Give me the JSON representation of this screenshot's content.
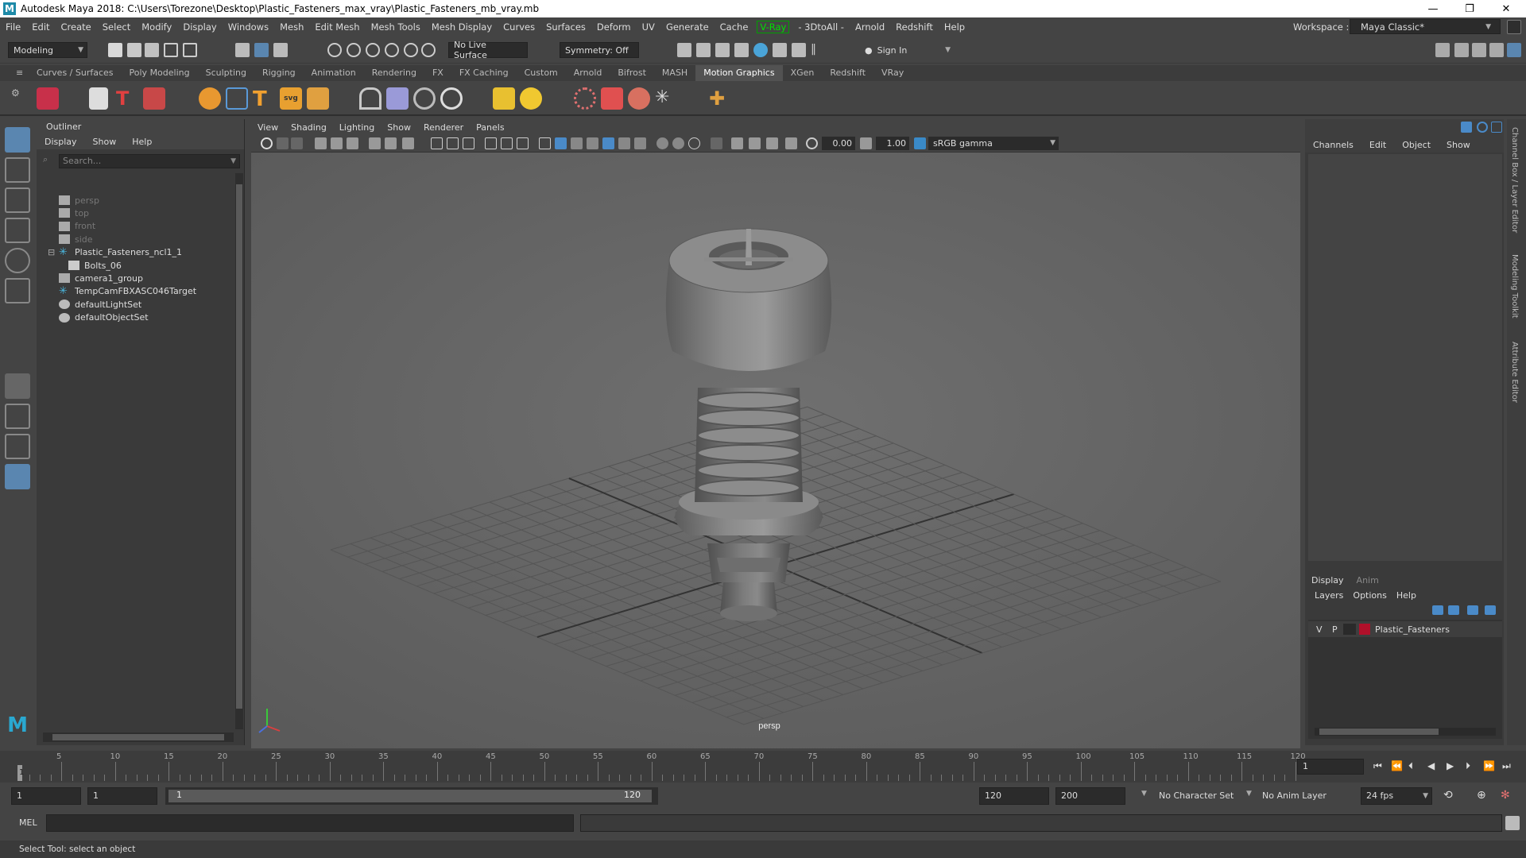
{
  "window": {
    "title": "Autodesk Maya 2018: C:\\Users\\Torezone\\Desktop\\Plastic_Fasteners_max_vray\\Plastic_Fasteners_mb_vray.mb",
    "app_icon": "M"
  },
  "menu": [
    "File",
    "Edit",
    "Create",
    "Select",
    "Modify",
    "Display",
    "Windows",
    "Mesh",
    "Edit Mesh",
    "Mesh Tools",
    "Mesh Display",
    "Curves",
    "Surfaces",
    "Deform",
    "UV",
    "Generate",
    "Cache"
  ],
  "menu_vray": "V-Ray",
  "menu2": [
    "- 3DtoAll -",
    "Arnold",
    "Redshift",
    "Help"
  ],
  "workspace": {
    "label": "Workspace :",
    "value": "Maya Classic*"
  },
  "status": {
    "mode": "Modeling",
    "live_surface": "No Live Surface",
    "symmetry": "Symmetry: Off",
    "sign_in": "Sign In"
  },
  "shelf_tabs": [
    "Curves / Surfaces",
    "Poly Modeling",
    "Sculpting",
    "Rigging",
    "Animation",
    "Rendering",
    "FX",
    "FX Caching",
    "Custom",
    "Arnold",
    "Bifrost",
    "MASH",
    "Motion Graphics",
    "XGen",
    "Redshift",
    "VRay"
  ],
  "shelf_active": "Motion Graphics",
  "outliner": {
    "title": "Outliner",
    "menu": [
      "Display",
      "Show",
      "Help"
    ],
    "search_placeholder": "Search...",
    "items": [
      {
        "label": "persp",
        "dim": true,
        "indent": 0,
        "icon": "camera-icon"
      },
      {
        "label": "top",
        "dim": true,
        "indent": 0,
        "icon": "camera-icon"
      },
      {
        "label": "front",
        "dim": true,
        "indent": 0,
        "icon": "camera-icon"
      },
      {
        "label": "side",
        "dim": true,
        "indent": 0,
        "icon": "camera-icon"
      },
      {
        "label": "Plastic_Fasteners_ncl1_1",
        "dim": false,
        "indent": 0,
        "icon": "joint-icon",
        "expand": "⊟"
      },
      {
        "label": "Bolts_06",
        "dim": false,
        "indent": 1,
        "icon": "mesh-icon"
      },
      {
        "label": "camera1_group",
        "dim": false,
        "indent": 0,
        "icon": "group-icon"
      },
      {
        "label": "TempCamFBXASC046Target",
        "dim": false,
        "indent": 0,
        "icon": "joint-icon"
      },
      {
        "label": "defaultLightSet",
        "dim": false,
        "indent": 0,
        "icon": "set-icon"
      },
      {
        "label": "defaultObjectSet",
        "dim": false,
        "indent": 0,
        "icon": "set-icon"
      }
    ]
  },
  "viewport": {
    "menu": [
      "View",
      "Shading",
      "Lighting",
      "Show",
      "Renderer",
      "Panels"
    ],
    "exposure": "0.00",
    "gamma": "1.00",
    "colorspace": "sRGB gamma",
    "camera_label": "persp"
  },
  "channelbox": {
    "menu": [
      "Channels",
      "Edit",
      "Object",
      "Show"
    ],
    "tabs": [
      "Display",
      "Anim"
    ],
    "layer_menu": [
      "Layers",
      "Options",
      "Help"
    ],
    "layer": {
      "v": "V",
      "p": "P",
      "name": "Plastic_Fasteners",
      "color": "#b0102a"
    }
  },
  "side_tabs": [
    "Channel Box / Layer Editor",
    "Modeling Toolkit",
    "Attribute Editor"
  ],
  "timeline": {
    "ticks": [
      "5",
      "10",
      "15",
      "20",
      "25",
      "30",
      "35",
      "40",
      "45",
      "50",
      "55",
      "60",
      "65",
      "70",
      "75",
      "80",
      "85",
      "90",
      "95",
      "100",
      "105",
      "110",
      "115",
      "120"
    ],
    "start": "1",
    "current": "1"
  },
  "range": {
    "start": "1",
    "start2": "1",
    "slider_start": "1",
    "slider_end": "120",
    "end": "120",
    "end2": "200",
    "character_set": "No Character Set",
    "anim_layer": "No Anim Layer",
    "fps": "24 fps"
  },
  "cmd": {
    "label": "MEL"
  },
  "help": "Select Tool: select an object"
}
